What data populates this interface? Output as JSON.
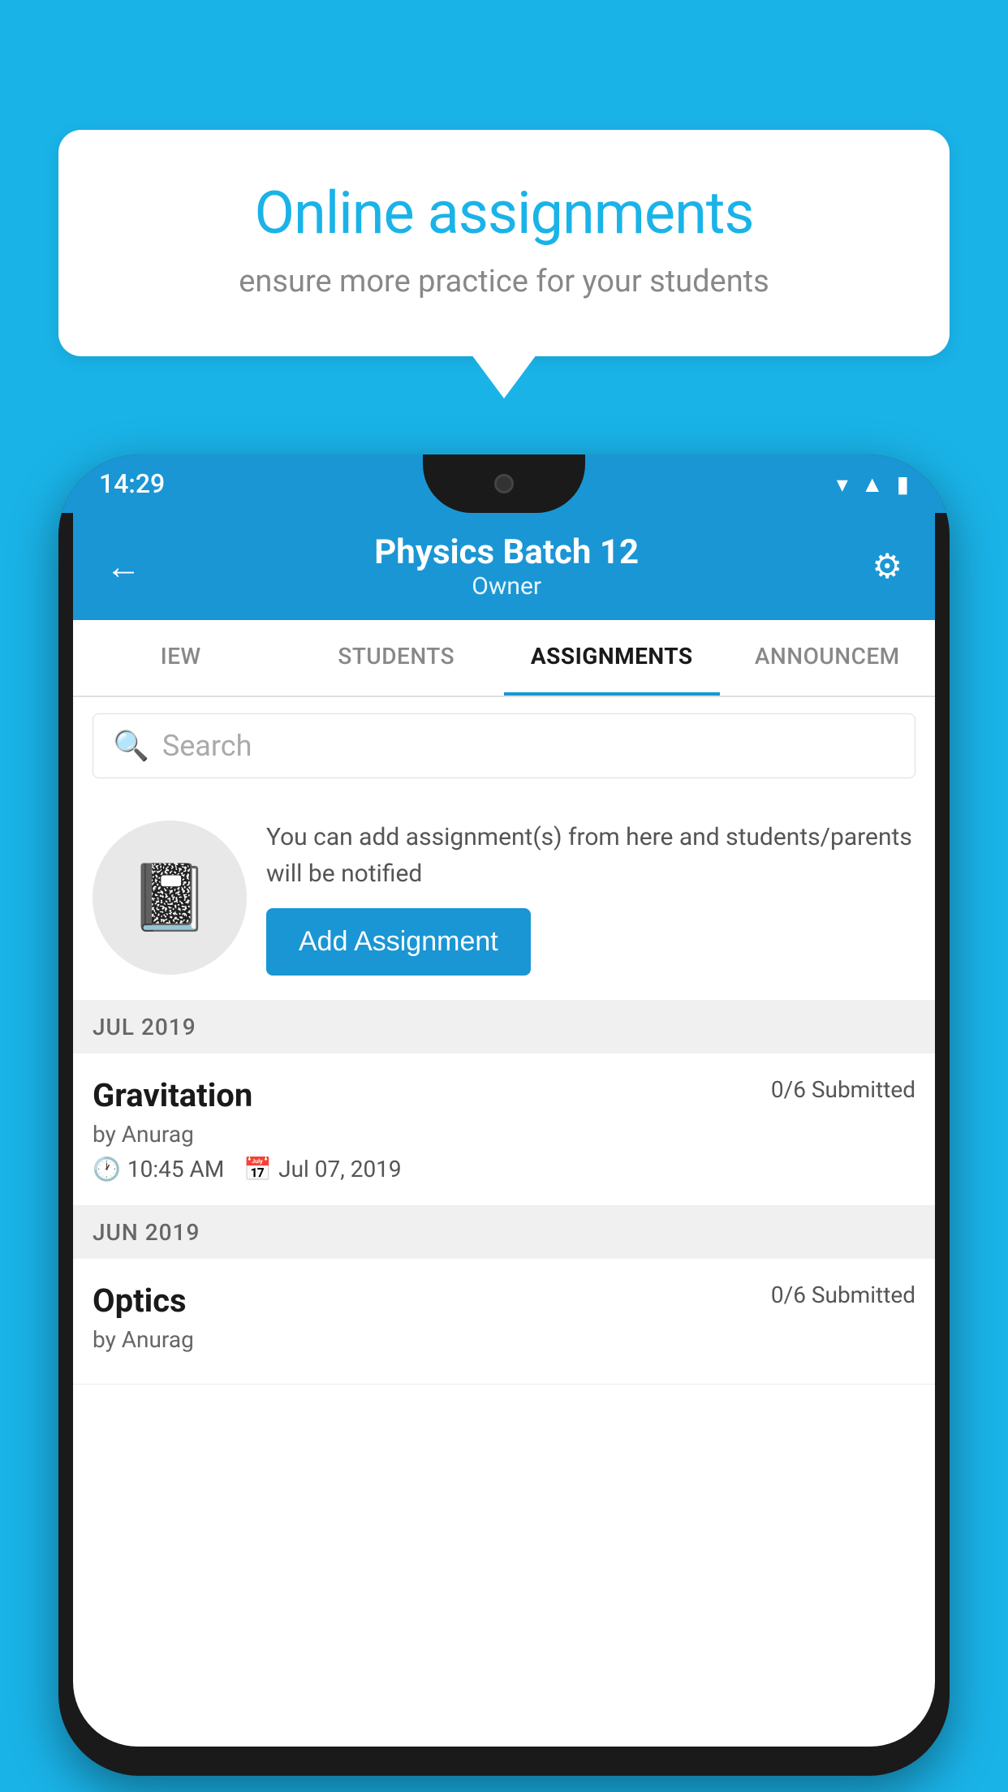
{
  "background_color": "#1ab3e8",
  "speech_bubble": {
    "title": "Online assignments",
    "subtitle": "ensure more practice for your students"
  },
  "phone": {
    "status_bar": {
      "time": "14:29",
      "icons": [
        "wifi",
        "signal",
        "battery"
      ]
    },
    "header": {
      "title": "Physics Batch 12",
      "subtitle": "Owner",
      "back_label": "←",
      "settings_label": "⚙"
    },
    "tabs": [
      {
        "label": "IEW",
        "active": false
      },
      {
        "label": "STUDENTS",
        "active": false
      },
      {
        "label": "ASSIGNMENTS",
        "active": true
      },
      {
        "label": "ANNOUNCEM",
        "active": false
      }
    ],
    "search": {
      "placeholder": "Search"
    },
    "info_card": {
      "description": "You can add assignment(s) from here and students/parents will be notified",
      "button_label": "Add Assignment"
    },
    "sections": [
      {
        "month": "JUL 2019",
        "assignments": [
          {
            "name": "Gravitation",
            "submitted": "0/6 Submitted",
            "author": "by Anurag",
            "time": "10:45 AM",
            "date": "Jul 07, 2019"
          }
        ]
      },
      {
        "month": "JUN 2019",
        "assignments": [
          {
            "name": "Optics",
            "submitted": "0/6 Submitted",
            "author": "by Anurag",
            "time": "",
            "date": ""
          }
        ]
      }
    ]
  }
}
